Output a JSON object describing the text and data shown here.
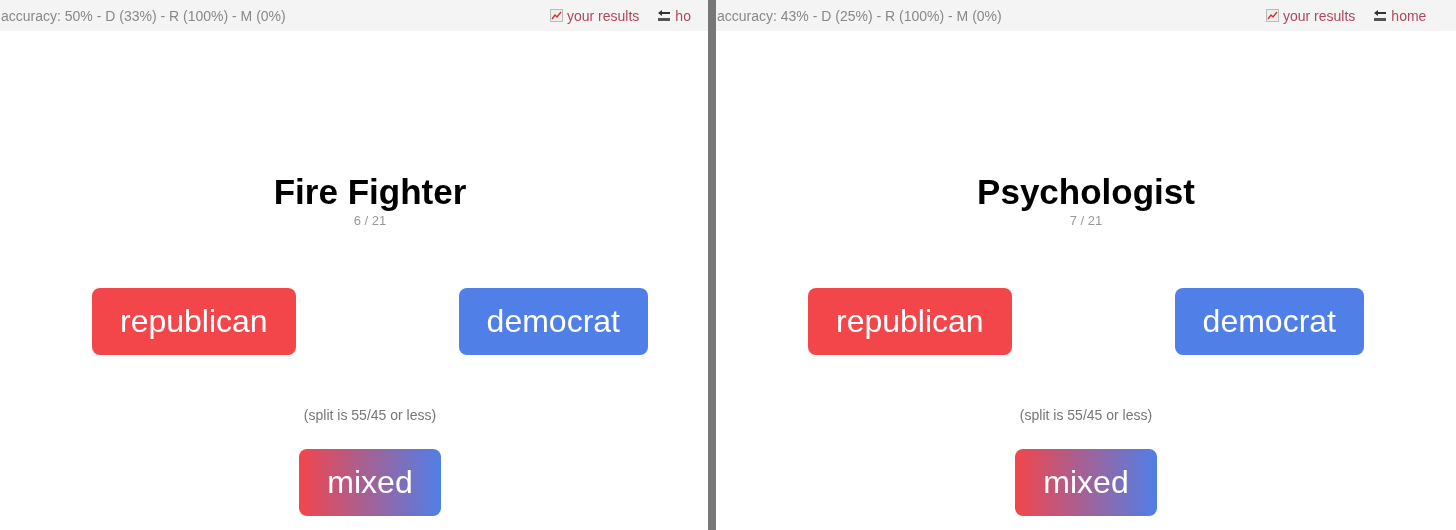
{
  "panels": [
    {
      "stats": "accuracy: 50% - D (33%) - R (100%) - M (0%)",
      "links": [
        {
          "kind": "results",
          "label": "your results"
        },
        {
          "kind": "home",
          "label": "ho"
        }
      ],
      "title": "Fire Fighter",
      "progress": "6 / 21",
      "answers": [
        {
          "kind": "republican",
          "label": "republican"
        },
        {
          "kind": "democrat",
          "label": "democrat"
        }
      ],
      "note": "(split is 55/45 or less)",
      "mixed": {
        "kind": "mixed",
        "label": "mixed"
      }
    },
    {
      "stats": "accuracy: 43% - D (25%) - R (100%) - M (0%)",
      "links": [
        {
          "kind": "results",
          "label": "your results"
        },
        {
          "kind": "home",
          "label": "home"
        }
      ],
      "title": "Psychologist",
      "progress": "7 / 21",
      "answers": [
        {
          "kind": "republican",
          "label": "republican"
        },
        {
          "kind": "democrat",
          "label": "democrat"
        }
      ],
      "note": "(split is 55/45 or less)",
      "mixed": {
        "kind": "mixed",
        "label": "mixed"
      }
    }
  ]
}
